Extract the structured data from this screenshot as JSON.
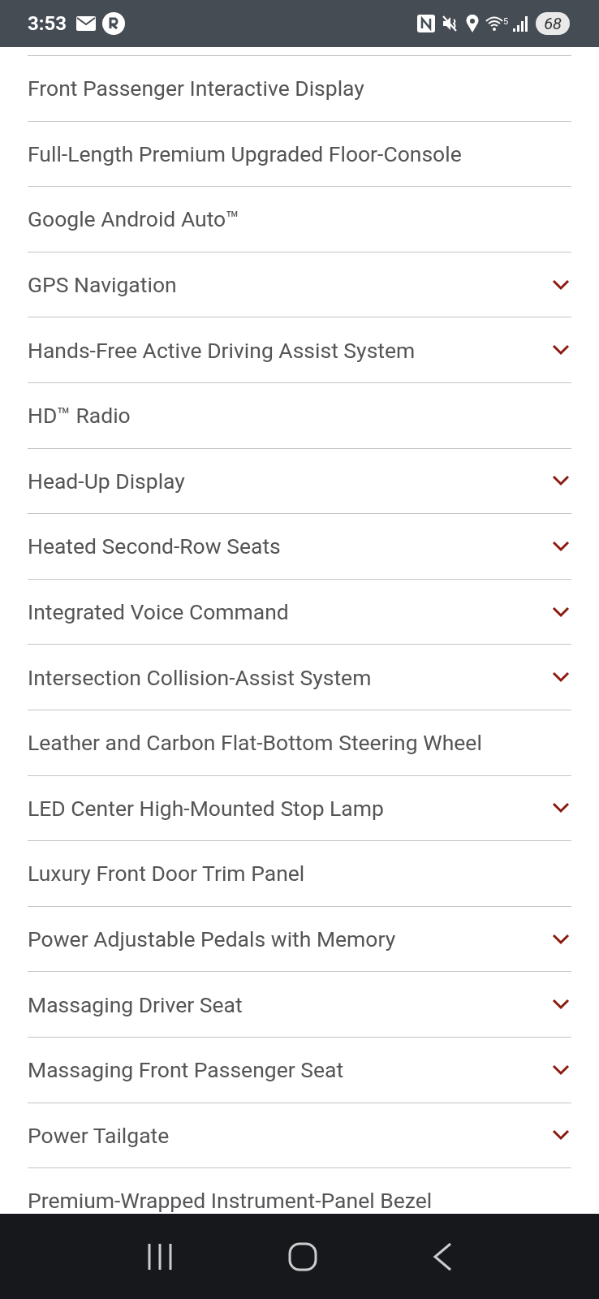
{
  "status_bar": {
    "time": "3:53",
    "wifi_label": "5",
    "battery": "68"
  },
  "features": [
    {
      "label": "Front Passenger Interactive Display",
      "expandable": false
    },
    {
      "label": "Full-Length Premium Upgraded Floor-Console",
      "expandable": false
    },
    {
      "label": "Google Android Auto™",
      "expandable": false
    },
    {
      "label": "GPS Navigation",
      "expandable": true
    },
    {
      "label": "Hands-Free Active Driving Assist System",
      "expandable": true
    },
    {
      "label": "HD™ Radio",
      "expandable": false
    },
    {
      "label": "Head-Up Display",
      "expandable": true
    },
    {
      "label": "Heated Second-Row Seats",
      "expandable": true
    },
    {
      "label": "Integrated Voice Command",
      "expandable": true
    },
    {
      "label": "Intersection Collision-Assist System",
      "expandable": true
    },
    {
      "label": "Leather and Carbon Flat-Bottom Steering Wheel",
      "expandable": false
    },
    {
      "label": "LED Center High-Mounted Stop Lamp",
      "expandable": true
    },
    {
      "label": "Luxury Front Door Trim Panel",
      "expandable": false
    },
    {
      "label": "Power Adjustable Pedals with Memory",
      "expandable": true
    },
    {
      "label": "Massaging Driver Seat",
      "expandable": true
    },
    {
      "label": "Massaging Front Passenger Seat",
      "expandable": true
    },
    {
      "label": "Power Tailgate",
      "expandable": true
    },
    {
      "label": "Premium-Wrapped Instrument-Panel Bezel",
      "expandable": false
    }
  ]
}
